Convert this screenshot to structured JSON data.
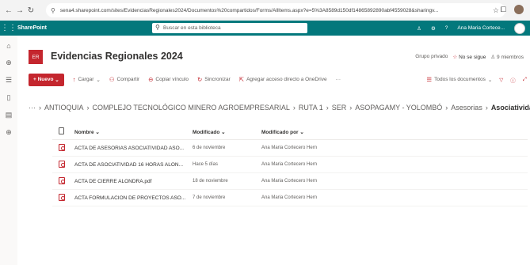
{
  "browser": {
    "url": "sena4.sharepoint.com/sites/EvidenciasRegionales2024/Documentos%20compartidos/Forms/AllItems.aspx?e=5%3A8589d150df14865892890abf4559028&sharingv...",
    "back": "←",
    "forward": "→",
    "reload": "↻"
  },
  "suite": {
    "brand": "SharePoint",
    "search_placeholder": "Buscar en esta biblioteca",
    "user": "Ana Maria Cortece..."
  },
  "site": {
    "logo_text": "ER",
    "title": "Evidencias Regionales 2024",
    "privacy": "Grupo privado",
    "follow": "No se sigue",
    "members": "9 miembros"
  },
  "toolbar": {
    "new": "+ Nuevo",
    "upload": "Cargar",
    "share": "Compartir",
    "copy_link": "Copiar vínculo",
    "sync": "Sincronizar",
    "shortcut": "Agregar acceso directo a OneDrive",
    "more": "···",
    "view": "Todos los documentos"
  },
  "breadcrumb": {
    "ellipsis": "···",
    "items": [
      "ANTIOQUIA",
      "COMPLEJO TECNOLÓGICO MINERO AGROEMPRESARIAL",
      "RUTA 1",
      "SER",
      "ASOPAGAMY - YOLOMBÓ",
      "Asesorias"
    ],
    "current": "Asociatividad"
  },
  "list": {
    "headers": {
      "name": "Nombre",
      "modified": "Modificado",
      "modified_by": "Modificado por"
    },
    "rows": [
      {
        "name": "ACTA  DE ASESORIAS ASOCIATIVIDAD ASO...",
        "modified": "6 de noviembre",
        "modified_by": "Ana Maria Cortecero Hern"
      },
      {
        "name": "ACTA DE ASOCIATIVIDAD 16 HORAS ALON...",
        "modified": "Hace 5 días",
        "modified_by": "Ana Maria Cortecero Hern"
      },
      {
        "name": "ACTA DE CIERRE ALONDRA.pdf",
        "modified": "18 de noviembre",
        "modified_by": "Ana Maria Cortecero Hern"
      },
      {
        "name": "ACTA FORMULACION DE PROYECTOS ASO...",
        "modified": "7 de noviembre",
        "modified_by": "Ana Maria Cortecero Hern"
      }
    ]
  },
  "colors": {
    "suite_bar": "#03787c",
    "accent": "#c4262e"
  }
}
